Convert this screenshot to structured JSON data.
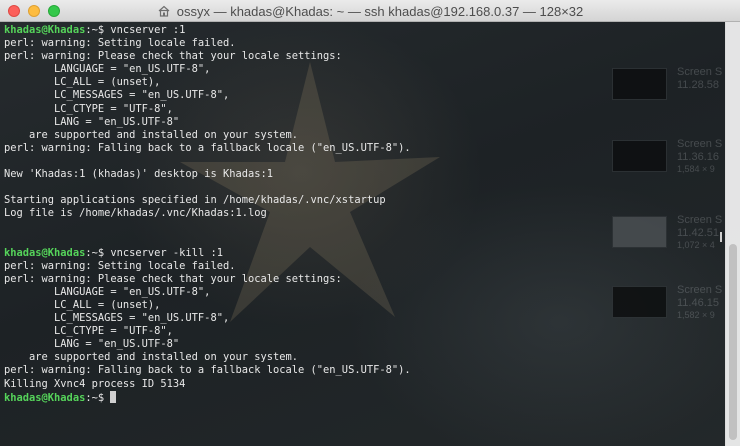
{
  "window": {
    "title": "ossyx — khadas@Khadas: ~ — ssh khadas@192.168.0.37 — 128×32"
  },
  "desktop_thumbnails": [
    {
      "name": "Screen S",
      "time": "11.28.58",
      "size": ""
    },
    {
      "name": "Screen S",
      "time": "11.36.16",
      "size": "1,584 × 9"
    },
    {
      "name": "Screen S",
      "time": "11.42.51",
      "size": "1,072 × 4"
    },
    {
      "name": "Screen S",
      "time": "11.46.15",
      "size": "1,582 × 9"
    }
  ],
  "terminal": {
    "lines": [
      {
        "prompt": "khadas@Khadas",
        "sep": ":~$ ",
        "text": "vncserver :1"
      },
      {
        "text": "perl: warning: Setting locale failed."
      },
      {
        "text": "perl: warning: Please check that your locale settings:"
      },
      {
        "text": "        LANGUAGE = \"en_US.UTF-8\","
      },
      {
        "text": "        LC_ALL = (unset),"
      },
      {
        "text": "        LC_MESSAGES = \"en_US.UTF-8\","
      },
      {
        "text": "        LC_CTYPE = \"UTF-8\","
      },
      {
        "text": "        LANG = \"en_US.UTF-8\""
      },
      {
        "text": "    are supported and installed on your system."
      },
      {
        "text": "perl: warning: Falling back to a fallback locale (\"en_US.UTF-8\")."
      },
      {
        "text": ""
      },
      {
        "text": "New 'Khadas:1 (khadas)' desktop is Khadas:1"
      },
      {
        "text": ""
      },
      {
        "text": "Starting applications specified in /home/khadas/.vnc/xstartup"
      },
      {
        "text": "Log file is /home/khadas/.vnc/Khadas:1.log"
      },
      {
        "text": ""
      },
      {
        "text": ""
      },
      {
        "prompt": "khadas@Khadas",
        "sep": ":~$ ",
        "text": "vncserver -kill :1"
      },
      {
        "text": "perl: warning: Setting locale failed."
      },
      {
        "text": "perl: warning: Please check that your locale settings:"
      },
      {
        "text": "        LANGUAGE = \"en_US.UTF-8\","
      },
      {
        "text": "        LC_ALL = (unset),"
      },
      {
        "text": "        LC_MESSAGES = \"en_US.UTF-8\","
      },
      {
        "text": "        LC_CTYPE = \"UTF-8\","
      },
      {
        "text": "        LANG = \"en_US.UTF-8\""
      },
      {
        "text": "    are supported and installed on your system."
      },
      {
        "text": "perl: warning: Falling back to a fallback locale (\"en_US.UTF-8\")."
      },
      {
        "text": "Killing Xvnc4 process ID 5134"
      },
      {
        "prompt": "khadas@Khadas",
        "sep": ":~$ ",
        "text": "",
        "cursor": true
      }
    ]
  },
  "colors": {
    "prompt": "#55d35a",
    "text": "#e8e8e8",
    "background": "#1c2124"
  },
  "icons": {
    "window_close": "close-icon",
    "window_minimize": "minimize-icon",
    "window_zoom": "zoom-icon",
    "title": "home-folder-icon"
  }
}
